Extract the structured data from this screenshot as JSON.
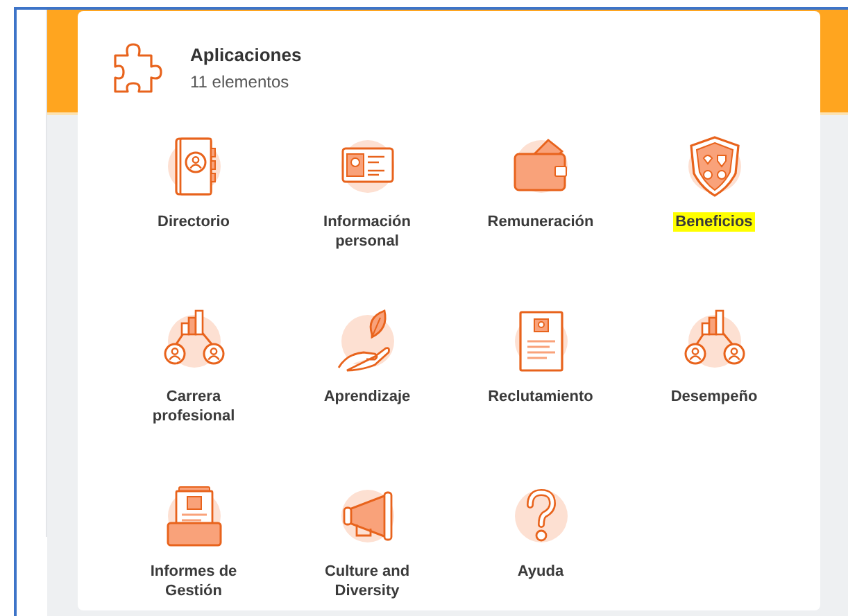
{
  "panel": {
    "title": "Aplicaciones",
    "subtitle": "11 elementos"
  },
  "apps": [
    {
      "label": "Directorio",
      "highlighted": false
    },
    {
      "label": "Información personal",
      "highlighted": false
    },
    {
      "label": "Remuneración",
      "highlighted": false
    },
    {
      "label": "Beneficios",
      "highlighted": true
    },
    {
      "label": "Carrera profesional",
      "highlighted": false
    },
    {
      "label": "Aprendizaje",
      "highlighted": false
    },
    {
      "label": "Reclutamiento",
      "highlighted": false
    },
    {
      "label": "Desempeño",
      "highlighted": false
    },
    {
      "label": "Informes de Gestión",
      "highlighted": false
    },
    {
      "label": "Culture and Diversity",
      "highlighted": false
    },
    {
      "label": "Ayuda",
      "highlighted": false
    }
  ]
}
